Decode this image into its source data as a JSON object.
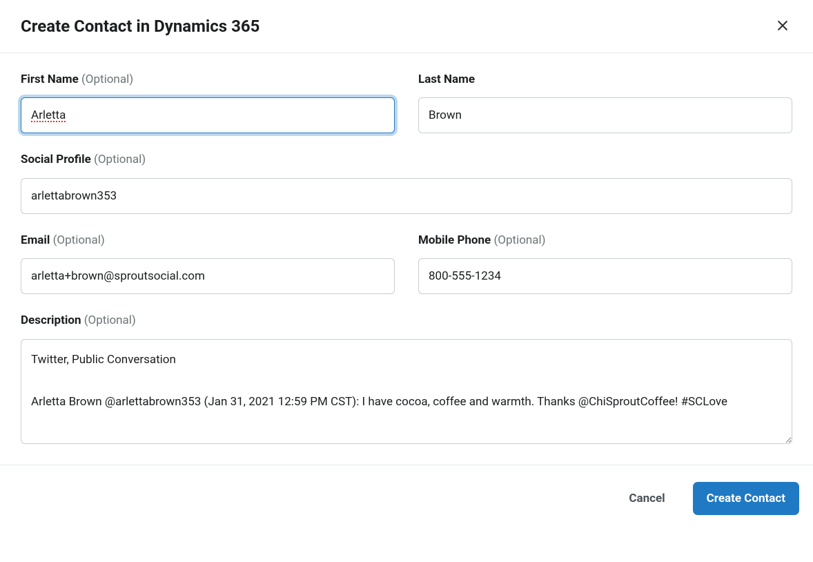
{
  "modal": {
    "title": "Create Contact in Dynamics 365"
  },
  "labels": {
    "first_name": "First Name",
    "last_name": "Last Name",
    "social_profile": "Social Profile",
    "email": "Email",
    "mobile_phone": "Mobile Phone",
    "description": "Description",
    "optional": "(Optional)"
  },
  "fields": {
    "first_name": "Arletta",
    "last_name": "Brown",
    "social_profile": "arlettabrown353",
    "email": "arletta+brown@sproutsocial.com",
    "mobile_phone": "800-555-1234",
    "description": "Twitter, Public Conversation\n\nArletta Brown @arlettabrown353 (Jan 31, 2021 12:59 PM CST): I have cocoa, coffee and warmth. Thanks @ChiSproutCoffee! #SCLove"
  },
  "buttons": {
    "cancel": "Cancel",
    "submit": "Create Contact"
  }
}
